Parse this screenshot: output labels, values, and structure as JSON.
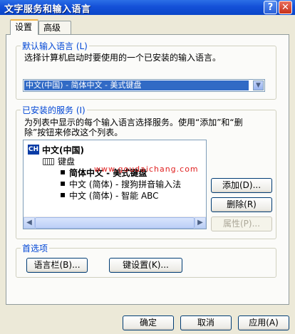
{
  "window": {
    "title": "文字服务和输入语言",
    "help_btn": "?",
    "close_btn": "✕"
  },
  "tabs": [
    {
      "label": "设置",
      "active": true
    },
    {
      "label": "高级",
      "active": false
    }
  ],
  "default_lang": {
    "group_title": "默认输入语言 (L)",
    "desc": "选择计算机启动时要使用的一个已安装的输入语言。",
    "selected": "中文(中国) - 简体中文 - 美式键盘"
  },
  "installed": {
    "group_title": "已安装的服务 (I)",
    "desc_line1": "为列表中显示的每个输入语言选择服务。使用“添加”和“删",
    "desc_line2": "除”按钮来修改这个列表。",
    "lang_badge": "CH",
    "lang_name": "中文(中国)",
    "keyboard_label": "键盘",
    "items": [
      "简体中文 - 美式键盘",
      "中文 (简体) - 搜狗拼音输入法",
      "中文 (简体) - 智能 ABC"
    ],
    "watermark": "www.goudaichang.com",
    "add_btn": "添加(D)...",
    "remove_btn": "删除(R)",
    "props_btn": "属性(P)..."
  },
  "prefs": {
    "group_title": "首选项",
    "langbar_btn": "语言栏(B)...",
    "keyset_btn": "键设置(K)..."
  },
  "footer": {
    "ok": "确定",
    "cancel": "取消",
    "apply": "应用(A)"
  },
  "colors": {
    "title_bar": "#0a46c8",
    "selection": "#316ac5",
    "group_title": "#0046d5",
    "dialog_bg": "#ece9d8"
  }
}
